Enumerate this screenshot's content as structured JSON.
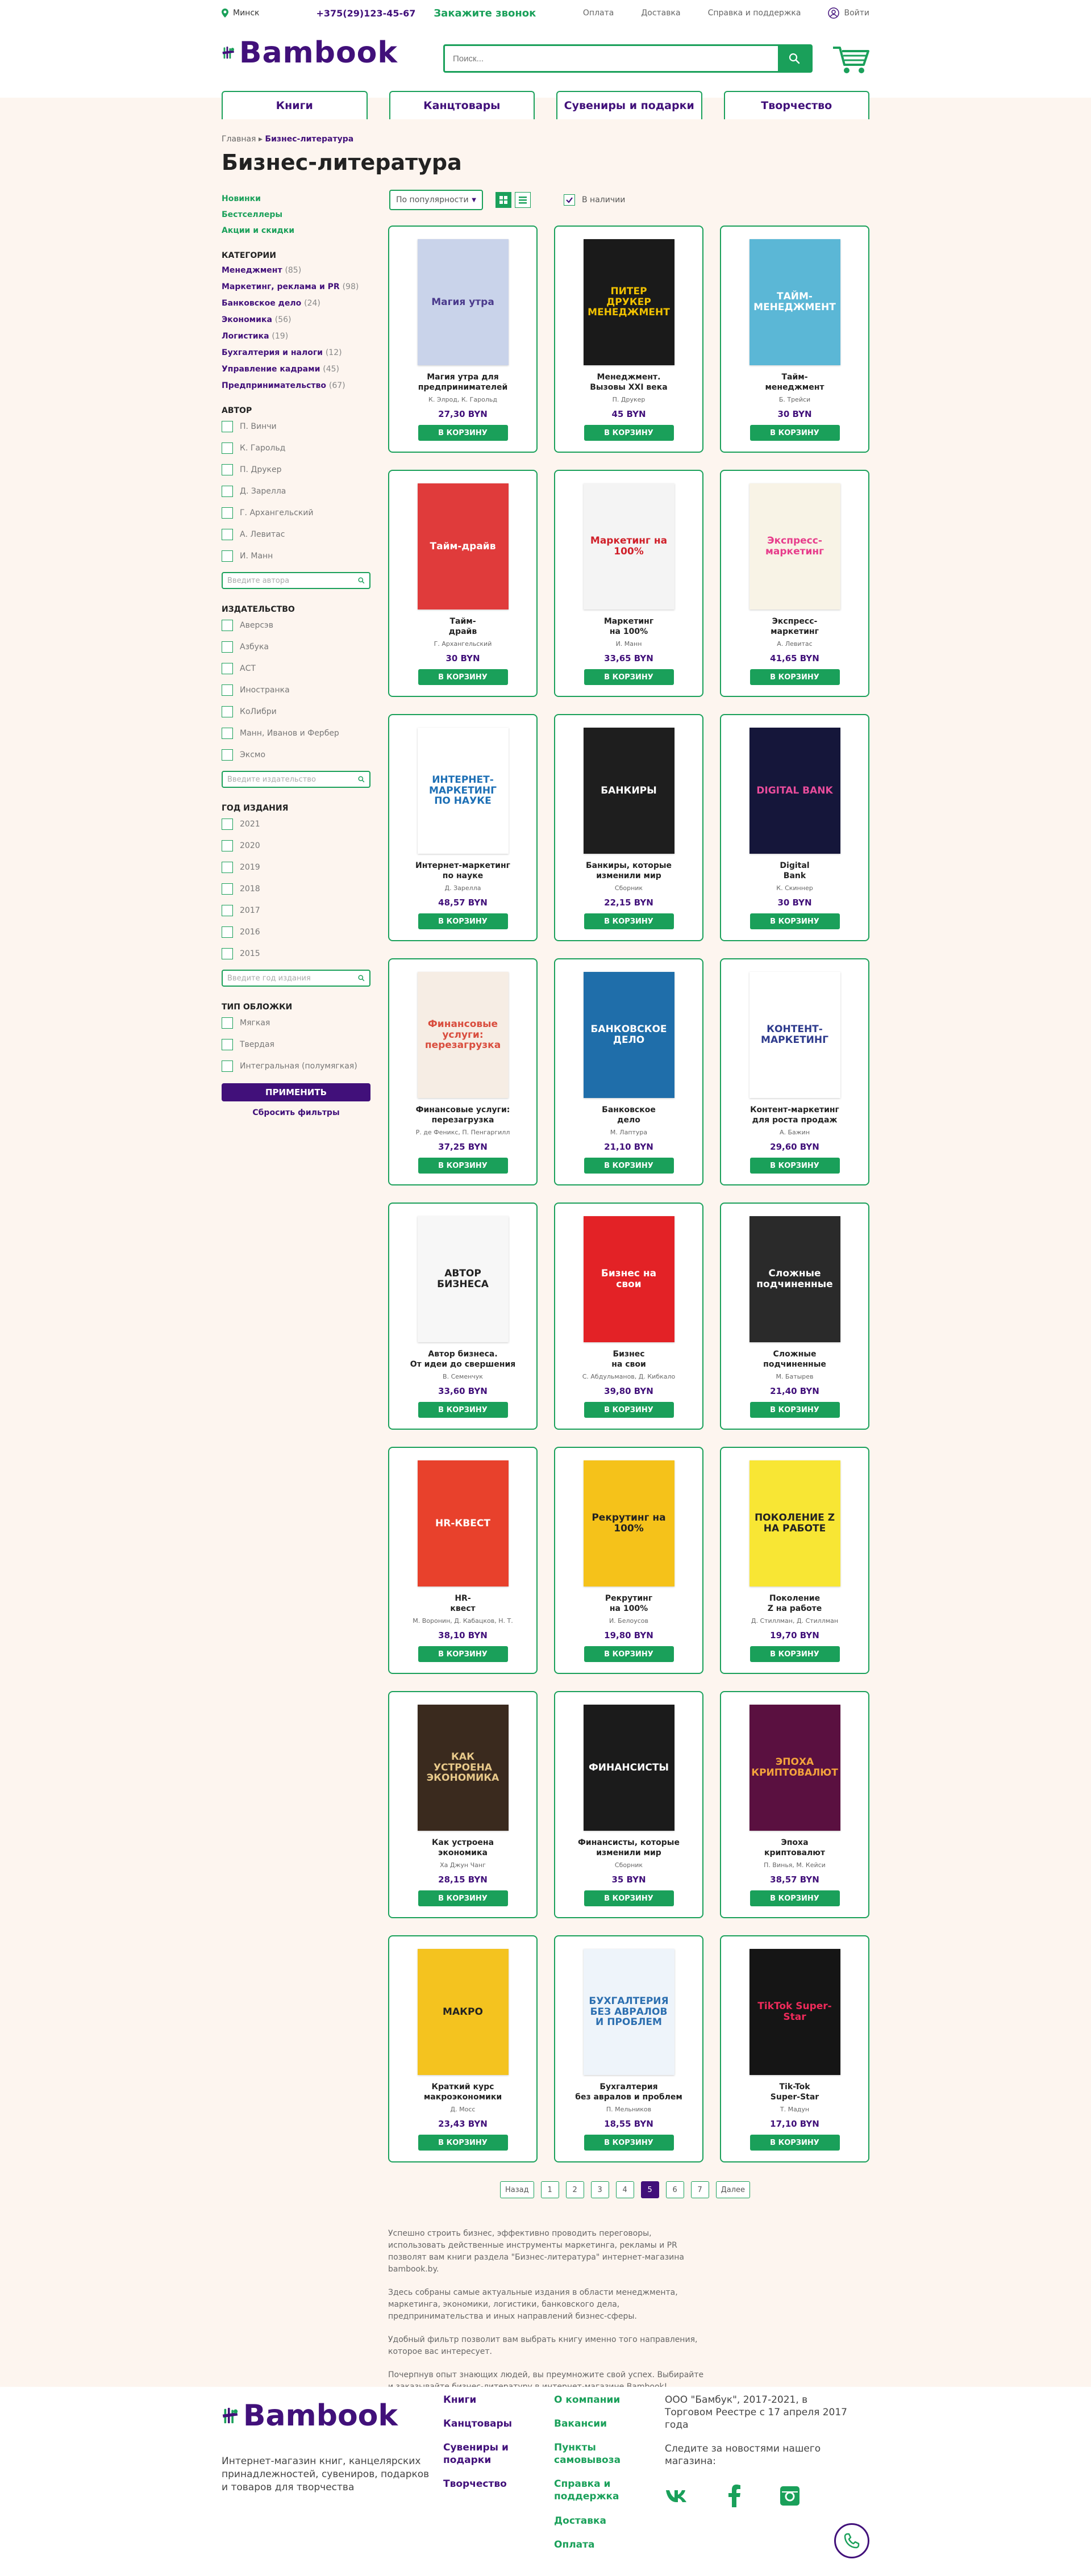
{
  "header": {
    "city": "Минск",
    "phone": "+375(29)123-45-67",
    "callback": "Закажите звонок",
    "links": [
      "Оплата",
      "Доставка",
      "Справка и поддержка"
    ],
    "login": "Войти",
    "logo": "Bambook",
    "search_placeholder": "Поиск..."
  },
  "nav": [
    "Книги",
    "Канцтовары",
    "Сувениры и подарки",
    "Творчество"
  ],
  "breadcrumb": {
    "home": "Главная",
    "current": "Бизнес-литература"
  },
  "page_title": "Бизнес-литература",
  "sidebar": {
    "top_links": [
      "Новинки",
      "Бестселлеры",
      "Акции и скидки"
    ],
    "categories_title": "КАТЕГОРИИ",
    "categories": [
      {
        "name": "Менеджмент",
        "count": "(85)"
      },
      {
        "name": "Маркетинг, реклама и PR",
        "count": "(98)"
      },
      {
        "name": "Банковское дело",
        "count": "(24)"
      },
      {
        "name": "Экономика",
        "count": "(56)"
      },
      {
        "name": "Логистика",
        "count": "(19)"
      },
      {
        "name": "Бухгалтерия и налоги",
        "count": "(12)"
      },
      {
        "name": "Управление кадрами",
        "count": "(45)"
      },
      {
        "name": "Предпринимательство",
        "count": "(67)"
      }
    ],
    "author_title": "АВТОР",
    "authors": [
      "П. Винчи",
      "К. Гарольд",
      "П. Друкер",
      "Д. Зарелла",
      "Г. Архангельский",
      "А. Левитас",
      "И. Манн"
    ],
    "author_placeholder": "Введите автора",
    "publisher_title": "ИЗДАТЕЛЬСТВО",
    "publishers": [
      "Аверсэв",
      "Азбука",
      "АСТ",
      "Иностранка",
      "КоЛибри",
      "Манн, Иванов и Фербер",
      "Эксмо"
    ],
    "publisher_placeholder": "Введите издательство",
    "year_title": "ГОД ИЗДАНИЯ",
    "years": [
      "2021",
      "2020",
      "2019",
      "2018",
      "2017",
      "2016",
      "2015"
    ],
    "year_placeholder": "Введите год издания",
    "cover_title": "ТИП ОБЛОЖКИ",
    "covers": [
      "Мягкая",
      "Твердая",
      "Интегральная (полумягкая)"
    ],
    "apply": "ПРИМЕНИТЬ",
    "reset": "Сбросить фильтры"
  },
  "toolbar": {
    "sort": "По популярности",
    "instock": "В наличии"
  },
  "buy_label": "В КОРЗИНУ",
  "products": [
    {
      "title": "Магия утра для\nпредпринимателей",
      "author": "К. Элрод, К. Гарольд",
      "price": "27,30 BYN",
      "cover_text": "Магия утра",
      "cover_bg": "#c9d3ea",
      "cover_fg": "#4a3a8c"
    },
    {
      "title": "Менеджмент.\nВызовы XXI века",
      "author": "П. Друкер",
      "price": "45 BYN",
      "cover_text": "ПИТЕР ДРУКЕР МЕНЕДЖМЕНТ",
      "cover_bg": "#1a1a1a",
      "cover_fg": "#f2c200"
    },
    {
      "title": "Тайм-\nменеджмент",
      "author": "Б. Трейси",
      "price": "30 BYN",
      "cover_text": "ТАЙМ-МЕНЕДЖМЕНТ",
      "cover_bg": "#5bb7d6",
      "cover_fg": "#ffffff"
    },
    {
      "title": "Тайм-\nдрайв",
      "author": "Г. Архангельский",
      "price": "30 BYN",
      "cover_text": "Тайм-драйв",
      "cover_bg": "#e03b3b",
      "cover_fg": "#ffffff"
    },
    {
      "title": "Маркетинг\nна 100%",
      "author": "И. Манн",
      "price": "33,65 BYN",
      "cover_text": "Маркетинг на 100%",
      "cover_bg": "#f4f4f4",
      "cover_fg": "#d0202a"
    },
    {
      "title": "Экспресс-\nмаркетинг",
      "author": "А. Левитас",
      "price": "41,65 BYN",
      "cover_text": "Экспресс-маркетинг",
      "cover_bg": "#f8f3e6",
      "cover_fg": "#e73c8b"
    },
    {
      "title": "Интернет-маркетинг\nпо науке",
      "author": "Д. Зарелла",
      "price": "48,57 BYN",
      "cover_text": "ИНТЕРНЕТ-МАРКЕТИНГ ПО НАУКЕ",
      "cover_bg": "#ffffff",
      "cover_fg": "#1d6fb5"
    },
    {
      "title": "Банкиры, которые\nизменили мир",
      "author": "Сборник",
      "price": "22,15 BYN",
      "cover_text": "БАНКИРЫ",
      "cover_bg": "#1e1e1e",
      "cover_fg": "#ffffff"
    },
    {
      "title": "Digital\nBank",
      "author": "К. Скиннер",
      "price": "30 BYN",
      "cover_text": "DIGITAL BANK",
      "cover_bg": "#15163a",
      "cover_fg": "#e84c9b"
    },
    {
      "title": "Финансовые услуги:\nперезагрузка",
      "author": "Р. де Феникс, П. Пенгаргилл",
      "price": "37,25 BYN",
      "cover_text": "Финансовые услуги: перезагрузка",
      "cover_bg": "#f6ede4",
      "cover_fg": "#d94d3e"
    },
    {
      "title": "Банковское\nдело",
      "author": "М. Лаптура",
      "price": "21,10 BYN",
      "cover_text": "БАНКОВСКОЕ ДЕЛО",
      "cover_bg": "#1f6eaa",
      "cover_fg": "#ffffff"
    },
    {
      "title": "Контент-маркетинг\nдля роста продаж",
      "author": "А. Бажин",
      "price": "29,60 BYN",
      "cover_text": "КОНТЕНТ-МАРКЕТИНГ",
      "cover_bg": "#ffffff",
      "cover_fg": "#2d3a8c"
    },
    {
      "title": "Автор бизнеса.\nОт идеи до свершения",
      "author": "В. Семенчук",
      "price": "33,60 BYN",
      "cover_text": "АВТОР БИЗНЕСА",
      "cover_bg": "#f7f7f7",
      "cover_fg": "#222222"
    },
    {
      "title": "Бизнес\nна свои",
      "author": "С. Абдульманов, Д. Кибкало",
      "price": "39,80 BYN",
      "cover_text": "Бизнес на свои",
      "cover_bg": "#e32226",
      "cover_fg": "#ffffff"
    },
    {
      "title": "Сложные\nподчиненные",
      "author": "М. Батырев",
      "price": "21,40 BYN",
      "cover_text": "Сложные подчиненные",
      "cover_bg": "#2a2a2a",
      "cover_fg": "#ffffff"
    },
    {
      "title": "HR-\nквест",
      "author": "М. Воронин, Д. Кабацков, Н. Т.",
      "price": "38,10 BYN",
      "cover_text": "HR-КВЕСТ",
      "cover_bg": "#e8412c",
      "cover_fg": "#ffffff"
    },
    {
      "title": "Рекрутинг\nна 100%",
      "author": "И. Белоусов",
      "price": "19,80 BYN",
      "cover_text": "Рекрутинг на 100%",
      "cover_bg": "#f5c21a",
      "cover_fg": "#222222"
    },
    {
      "title": "Поколение\nZ на работе",
      "author": "Д. Стиллман, Д. Стиллман",
      "price": "19,70 BYN",
      "cover_text": "ПОКОЛЕНИЕ Z НА РАБОТЕ",
      "cover_bg": "#f8e634",
      "cover_fg": "#222222"
    },
    {
      "title": "Как устроена\nэкономика",
      "author": "Ха Джун Чанг",
      "price": "28,15 BYN",
      "cover_text": "КАК УСТРОЕНА ЭКОНОМИКА",
      "cover_bg": "#3a2a1e",
      "cover_fg": "#e8c98a"
    },
    {
      "title": "Финансисты, которые\nизменили мир",
      "author": "Сборник",
      "price": "35 BYN",
      "cover_text": "ФИНАНСИСТЫ",
      "cover_bg": "#1b1b1b",
      "cover_fg": "#ffffff"
    },
    {
      "title": "Эпоха\nкриптовалют",
      "author": "П. Винья, М. Кейси",
      "price": "38,57 BYN",
      "cover_text": "ЭПОХА КРИПТОВАЛЮТ",
      "cover_bg": "#5a1040",
      "cover_fg": "#f3a33c"
    },
    {
      "title": "Краткий курс\nмакроэкономики",
      "author": "Д. Мосс",
      "price": "23,43 BYN",
      "cover_text": "МАКРО",
      "cover_bg": "#f4c31f",
      "cover_fg": "#222222"
    },
    {
      "title": "Бухгалтерия\nбез авралов и проблем",
      "author": "П. Мельников",
      "price": "18,55 BYN",
      "cover_text": "БУХГАЛТЕРИЯ БЕЗ АВРАЛОВ И ПРОБЛЕМ",
      "cover_bg": "#eef4fa",
      "cover_fg": "#2c6fb0"
    },
    {
      "title": "Tik-Tok\nSuper-Star",
      "author": "Т. Мадун",
      "price": "17,10 BYN",
      "cover_text": "TikTok Super-Star",
      "cover_bg": "#151515",
      "cover_fg": "#ee2a5a"
    }
  ],
  "pagination": {
    "prev": "Назад",
    "pages": [
      "1",
      "2",
      "3",
      "4",
      "5",
      "6",
      "7"
    ],
    "active": "5",
    "next": "Далее"
  },
  "seo": [
    "Успешно строить бизнес, эффективно проводить переговоры, использовать действенные инструменты маркетинга, рекламы и PR позволят вам книги раздела \"Бизнес-литература\" интернет-магазина bambook.by.",
    "Здесь собраны самые актуальные издания в области менеджмента, маркетинга, экономики, логистики, банковского дела, предпринимательства и иных направлений бизнес-сферы.",
    "Удобный фильтр позволит вам выбрать книгу именно того направления, которое вас интересует.",
    "Почерпнув опыт знающих людей, вы преумножите свой успех. Выбирайте и заказывайте бизнес-литературу в интернет-магазине Bambook!"
  ],
  "footer": {
    "logo": "Bambook",
    "desc": "Интернет-магазин книг, канцелярских принадлежностей, сувениров, подарков и товаров для творчества",
    "col1": [
      "Книги",
      "Канцтовары",
      "Сувениры и подарки",
      "Творчество"
    ],
    "col2": [
      "О компании",
      "Вакансии",
      "Пункты самовывоза",
      "Справка и поддержка",
      "Доставка",
      "Оплата"
    ],
    "company": "ООО \"Бамбук\", 2017-2021, в Торговом Реестре с 17 апреля 2017 года",
    "follow": "Следите за новостями нашего магазина:"
  },
  "colors": {
    "brand_green": "#1aa05a",
    "brand_purple": "#41107a",
    "page_bg": "#fdf5ef"
  }
}
